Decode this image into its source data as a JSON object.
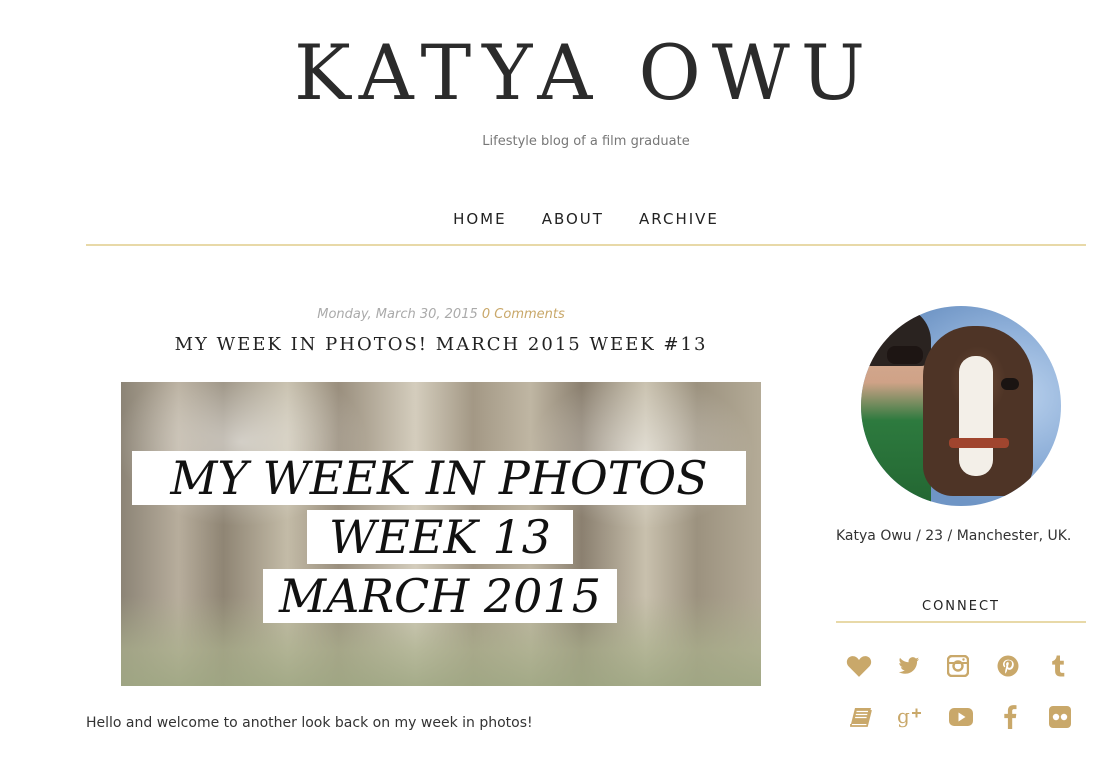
{
  "header": {
    "title": "KATYA OWU",
    "tagline": "Lifestyle blog of a film graduate"
  },
  "nav": {
    "items": [
      {
        "label": "HOME"
      },
      {
        "label": "ABOUT"
      },
      {
        "label": "ARCHIVE"
      }
    ]
  },
  "post": {
    "date": "Monday, March 30, 2015",
    "comments": "0 Comments",
    "title": "MY WEEK IN PHOTOS! MARCH 2015 WEEK #13",
    "image_text": {
      "line1": "MY WEEK IN PHOTOS",
      "line2": "WEEK 13",
      "line3": "MARCH 2015"
    },
    "body": "Hello and welcome to another look back on my week in photos!"
  },
  "sidebar": {
    "bio": "Katya Owu / 23 / Manchester, UK.",
    "connect_title": "CONNECT",
    "social_icons": [
      "heart-icon",
      "twitter-icon",
      "instagram-icon",
      "pinterest-icon",
      "tumblr-icon",
      "book-icon",
      "google-plus-icon",
      "youtube-icon",
      "facebook-icon",
      "flickr-icon"
    ]
  },
  "colors": {
    "accent": "#c9a86a",
    "rule": "#e8d9a8",
    "text": "#333333"
  }
}
